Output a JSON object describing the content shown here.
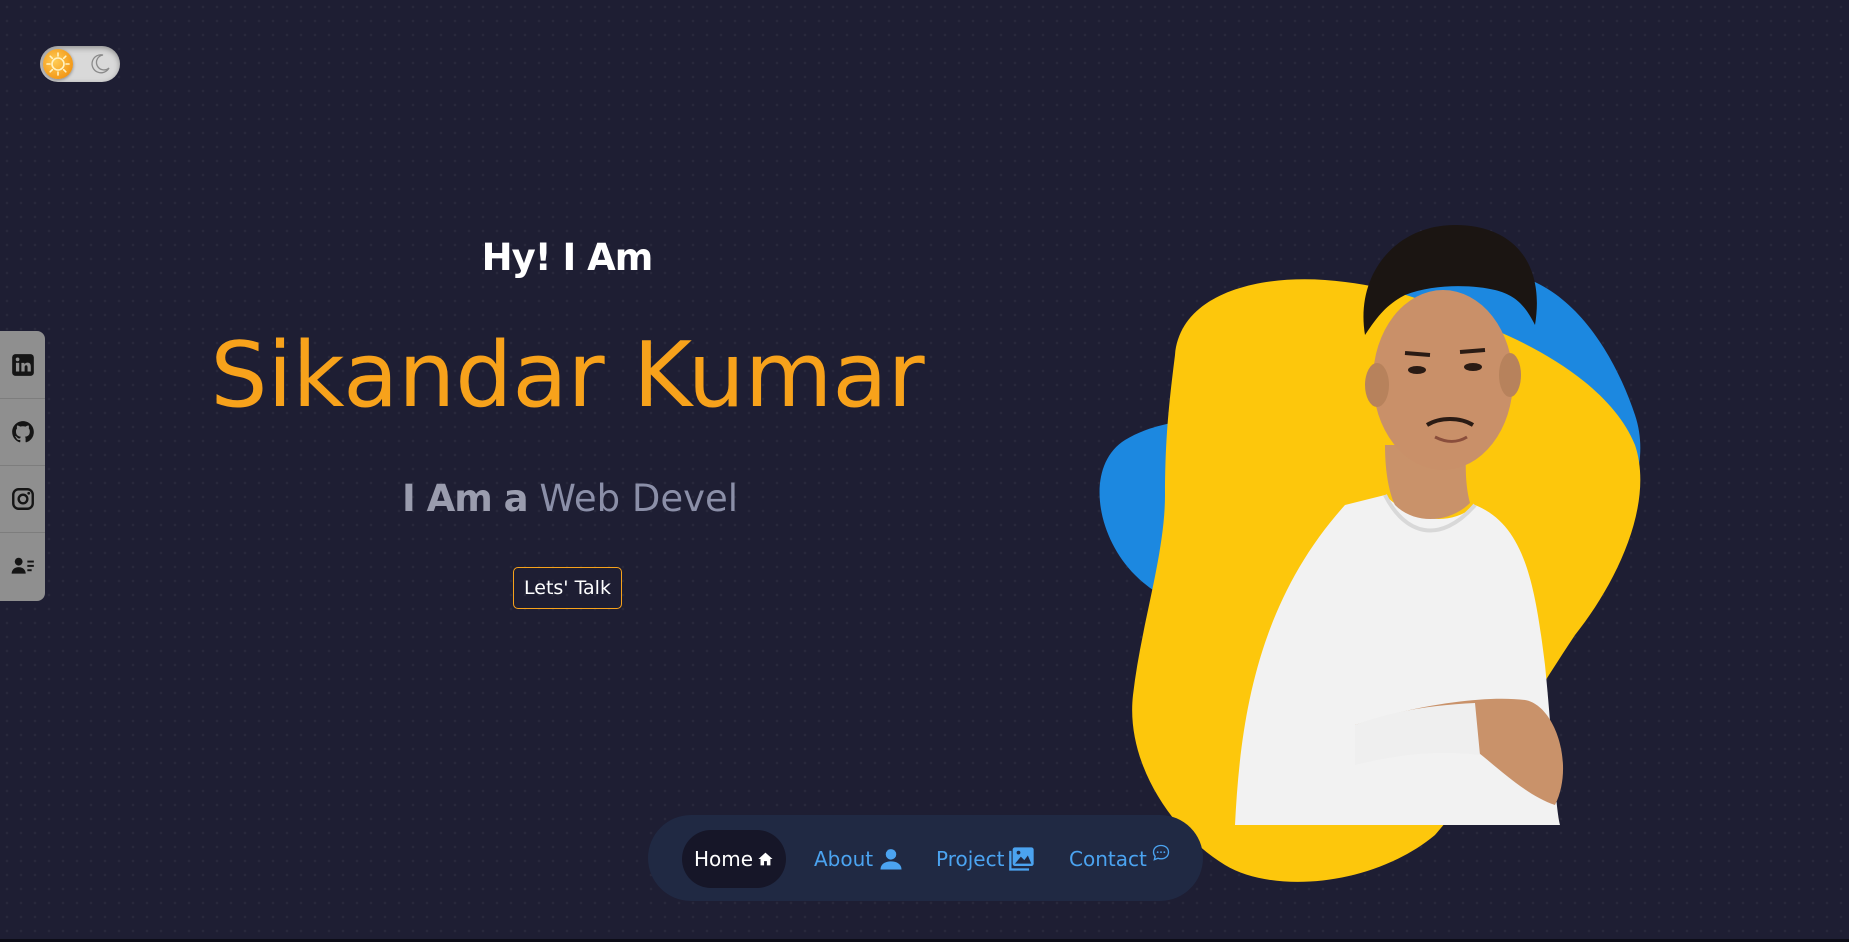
{
  "theme_toggle": {
    "sun_icon": "sun-icon",
    "moon_icon": "moon-icon",
    "mode": "dark"
  },
  "social": [
    {
      "name": "linkedin",
      "icon": "linkedin-icon"
    },
    {
      "name": "github",
      "icon": "github-icon"
    },
    {
      "name": "instagram",
      "icon": "instagram-icon"
    },
    {
      "name": "contact-card",
      "icon": "contact-card-icon"
    }
  ],
  "hero": {
    "greeting": "Hy! I Am",
    "name": "Sikandar Kumar",
    "role_prefix": "I Am a",
    "role_typed": "Web Devel",
    "cta_label": "Lets' Talk"
  },
  "nav": {
    "items": [
      {
        "label": "Home",
        "icon": "home-icon",
        "active": true
      },
      {
        "label": "About",
        "icon": "user-icon",
        "active": false
      },
      {
        "label": "Project",
        "icon": "image-icon",
        "active": false
      },
      {
        "label": "Contact",
        "icon": "chat-icon",
        "active": false
      }
    ]
  },
  "colors": {
    "background": "#1e1e33",
    "accent": "#f7a21b",
    "nav_link": "#4ba3f0",
    "blob_yellow": "#fdc70c",
    "blob_blue": "#1c88e0",
    "nav_background": "#202943"
  }
}
